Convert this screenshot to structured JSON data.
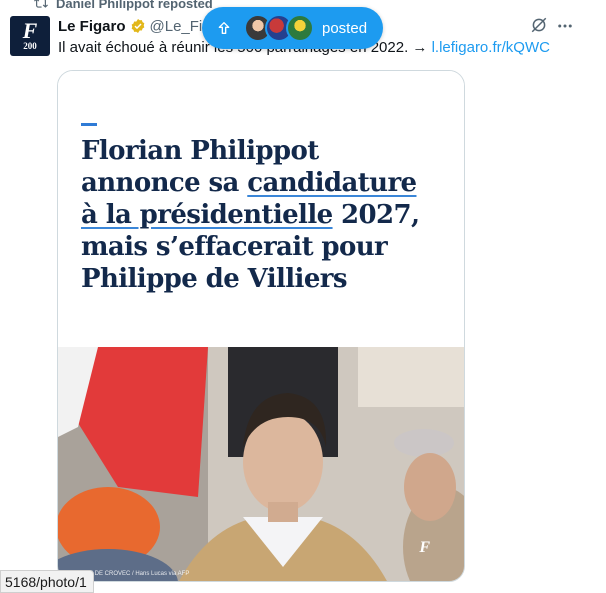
{
  "repost": {
    "label": "Daniel Philippot reposted",
    "icon": "repost-icon"
  },
  "tweet": {
    "author_name": "Le Figaro",
    "handle": "@Le_Fig",
    "text": "Il avait échoué à réunir les 500 parrainages en 2022. → ",
    "link": "l.lefigaro.fr/kQWC",
    "avatar": {
      "letter": "F",
      "number": "200"
    }
  },
  "new_posts_pill": {
    "label": "posted",
    "arrow_icon": "arrow-up-icon",
    "avatars": 3
  },
  "card": {
    "headline_line1": "Florian Philippot",
    "headline_line2_plain": "annonce sa ",
    "headline_line2_underlined": "candidature",
    "headline_line3_underlined": "à la présidentielle",
    "headline_line3_plain": " 2027,",
    "headline_line4": "mais s’effacerait pour",
    "headline_line5": "Philippe de Villiers",
    "photo_credit": "© MARTIN DE CROVEC / Hans Lucas via AFP",
    "photo_logo": "F"
  },
  "status_bar": {
    "url": "5168/photo/1"
  },
  "colors": {
    "accent": "#1d9bf0",
    "headline": "#13294b",
    "underline": "#3a86d8",
    "avatar_bg": "#0e1f3a"
  }
}
